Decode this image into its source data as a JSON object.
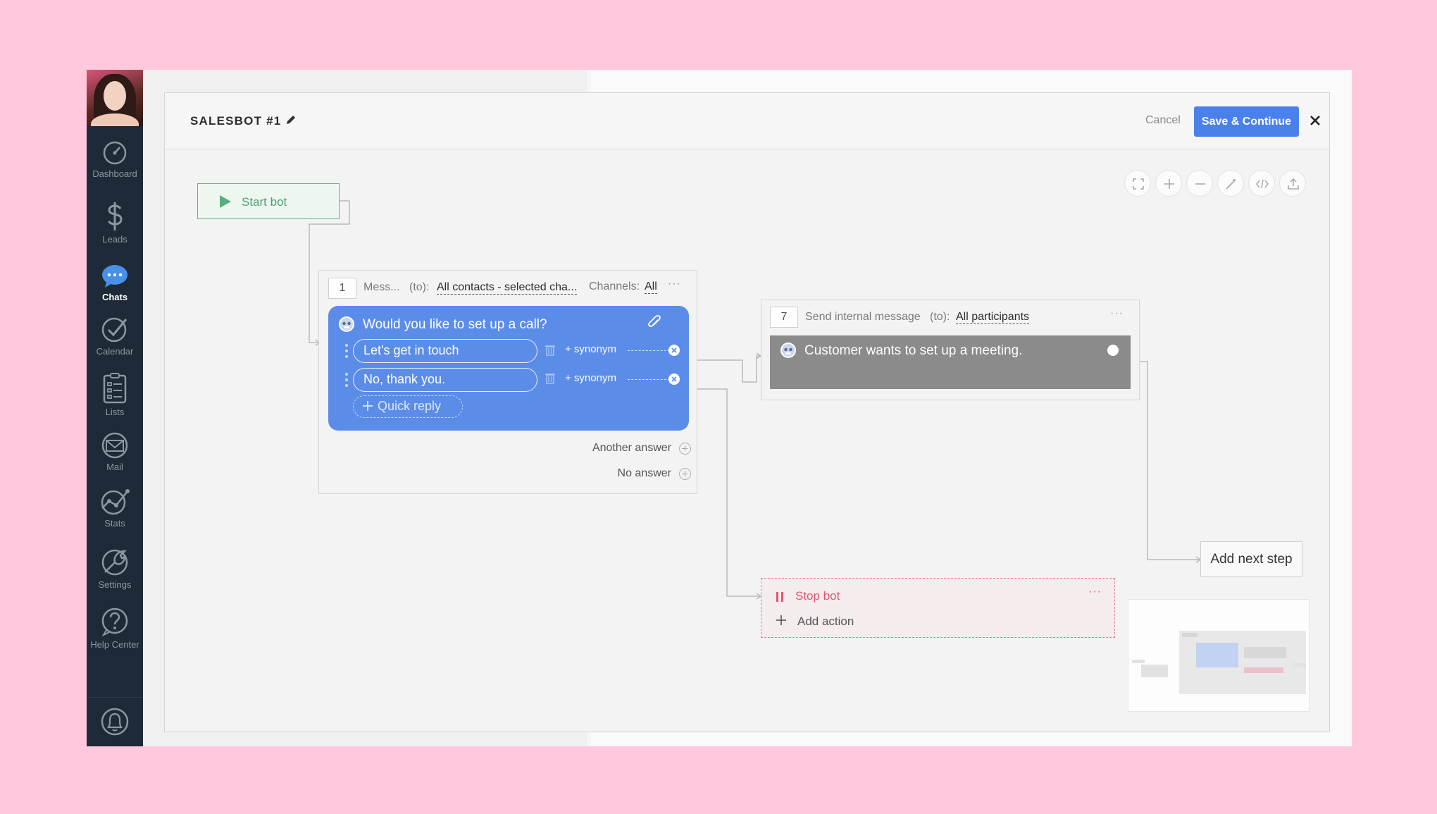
{
  "sidebar": {
    "items": [
      {
        "label": "Dashboard",
        "icon": "dashboard-icon"
      },
      {
        "label": "Leads",
        "icon": "dollar-icon"
      },
      {
        "label": "Chats",
        "icon": "chat-icon",
        "active": true
      },
      {
        "label": "Calendar",
        "icon": "check-icon"
      },
      {
        "label": "Lists",
        "icon": "list-icon"
      },
      {
        "label": "Mail",
        "icon": "mail-icon"
      },
      {
        "label": "Stats",
        "icon": "stats-icon"
      },
      {
        "label": "Settings",
        "icon": "wrench-icon"
      },
      {
        "label": "Help Center",
        "icon": "help-icon"
      }
    ]
  },
  "modal": {
    "title": "SALESBOT #1",
    "cancel_label": "Cancel",
    "save_label": "Save & Continue"
  },
  "canvas": {
    "start_label": "Start bot",
    "step1": {
      "number": "1",
      "type_label": "Mess...",
      "to_label": "(to):",
      "to_value": "All contacts - selected cha...",
      "channels_label": "Channels:",
      "channels_value": "All",
      "question": "Would you like to set up a call?",
      "replies": [
        {
          "text": "Let's get in touch",
          "synonym_label": "+ synonym"
        },
        {
          "text": "No, thank you.",
          "synonym_label": "+ synonym"
        }
      ],
      "quick_reply_label": "Quick reply",
      "another_answer_label": "Another answer",
      "no_answer_label": "No answer"
    },
    "step7": {
      "number": "7",
      "type_label": "Send internal message",
      "to_label": "(to):",
      "to_value": "All participants",
      "message": "Customer wants to set up a meeting."
    },
    "stop_bot": {
      "label": "Stop bot",
      "add_action_label": "Add action"
    },
    "add_next_label": "Add next step"
  },
  "colors": {
    "accent": "#4a80ea",
    "bubble": "#5b8de8",
    "start": "#67b487",
    "stop": "#e0566f",
    "sidebar": "#1e2a37",
    "background": "#ffc8dd"
  }
}
